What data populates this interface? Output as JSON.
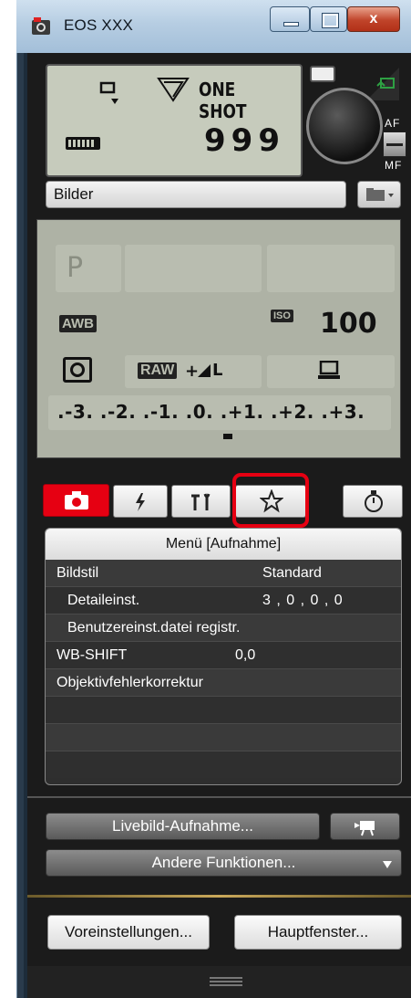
{
  "window": {
    "title": "EOS XXX",
    "close_glyph": "x"
  },
  "camera_lcd": {
    "af_mode": "ONE SHOT",
    "shots_remaining": "999"
  },
  "af_mf_switch": {
    "af_label": "AF",
    "mf_label": "MF"
  },
  "storage": {
    "folder_name": "Bilder"
  },
  "settings_lcd": {
    "mode": "P",
    "wb": "AWB",
    "iso_badge": "ISO",
    "iso_value": "100",
    "quality_raw": "RAW",
    "quality_plus": "+",
    "quality_size": "L",
    "exposure_scale": ".-3. .-2. .-1. .0. .+1. .+2. .+3."
  },
  "tabs": [
    {
      "name": "shooting",
      "icon": "camera-icon"
    },
    {
      "name": "flash",
      "icon": "lightning-icon"
    },
    {
      "name": "setup",
      "icon": "tools-icon"
    },
    {
      "name": "my-menu",
      "icon": "star-icon"
    },
    {
      "name": "timer",
      "icon": "stopwatch-icon"
    }
  ],
  "menu": {
    "header": "Menü [Aufnahme]",
    "rows": [
      {
        "label": "Bildstil",
        "value": "Standard"
      },
      {
        "label": "Detaileinst.",
        "value": "3 , 0 , 0 , 0"
      },
      {
        "label": "Benutzereinst.datei registr.",
        "value": ""
      },
      {
        "label": "WB-SHIFT",
        "value": "0,0"
      },
      {
        "label": "Objektivfehlerkorrektur",
        "value": ""
      }
    ]
  },
  "buttons": {
    "live_view": "Livebild-Aufnahme...",
    "other_functions": "Andere Funktionen...",
    "preferences": "Voreinstellungen...",
    "main_window": "Hauptfenster..."
  },
  "colors": {
    "tab_active": "#e60012",
    "highlight": "#e60012",
    "lcd": "#c6cbbc"
  }
}
